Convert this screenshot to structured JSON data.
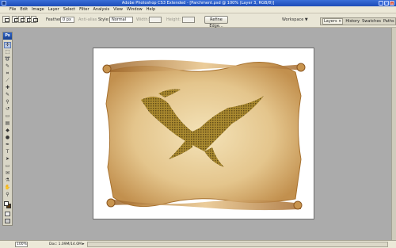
{
  "titlebar": {
    "title": "Adobe Photoshop CS3 Extended - [Parchment.psd @ 100% (Layer 3, RGB/8)]",
    "controls": [
      "_",
      "□",
      "x"
    ]
  },
  "menubar": {
    "items": [
      "File",
      "Edit",
      "Image",
      "Layer",
      "Select",
      "Filter",
      "Analysis",
      "View",
      "Window",
      "Help"
    ]
  },
  "options": {
    "feather_label": "Feather:",
    "feather_value": "0 px",
    "antialias_label": "Anti-alias",
    "style_label": "Style:",
    "style_value": "Normal",
    "width_label": "Width:",
    "height_label": "Height:",
    "refine_edge_label": "Refine Edge...",
    "workspace_label": "Workspace ▼"
  },
  "panel_tabs": {
    "items": [
      "Layers ×",
      "History",
      "Swatches",
      "Paths"
    ]
  },
  "toolbox": {
    "logo": "Ps",
    "tools": [
      {
        "name": "move-tool",
        "glyph": "✢"
      },
      {
        "name": "marquee-tool",
        "glyph": "⬚"
      },
      {
        "name": "lasso-tool",
        "glyph": "➰"
      },
      {
        "name": "quick-select-tool",
        "glyph": "✎"
      },
      {
        "name": "crop-tool",
        "glyph": "⌗"
      },
      {
        "name": "slice-tool",
        "glyph": "⟋"
      },
      {
        "name": "healing-tool",
        "glyph": "✚"
      },
      {
        "name": "brush-tool",
        "glyph": "✎"
      },
      {
        "name": "stamp-tool",
        "glyph": "⚲"
      },
      {
        "name": "history-brush-tool",
        "glyph": "↺"
      },
      {
        "name": "eraser-tool",
        "glyph": "▭"
      },
      {
        "name": "gradient-tool",
        "glyph": "▤"
      },
      {
        "name": "blur-tool",
        "glyph": "◆"
      },
      {
        "name": "dodge-tool",
        "glyph": "●"
      },
      {
        "name": "pen-tool",
        "glyph": "✒"
      },
      {
        "name": "type-tool",
        "glyph": "T"
      },
      {
        "name": "path-select-tool",
        "glyph": "➤"
      },
      {
        "name": "shape-tool",
        "glyph": "▭"
      },
      {
        "name": "notes-tool",
        "glyph": "✉"
      },
      {
        "name": "eyedropper-tool",
        "glyph": "⚗"
      },
      {
        "name": "hand-tool",
        "glyph": "✋"
      },
      {
        "name": "zoom-tool",
        "glyph": "⚲"
      }
    ],
    "colors": {
      "foreground": "#ffffff",
      "background": "#5a3a12"
    }
  },
  "status": {
    "zoom": "100%",
    "doc_info": "Doc: 1.09M/14.0M",
    "arrow": "▸"
  }
}
